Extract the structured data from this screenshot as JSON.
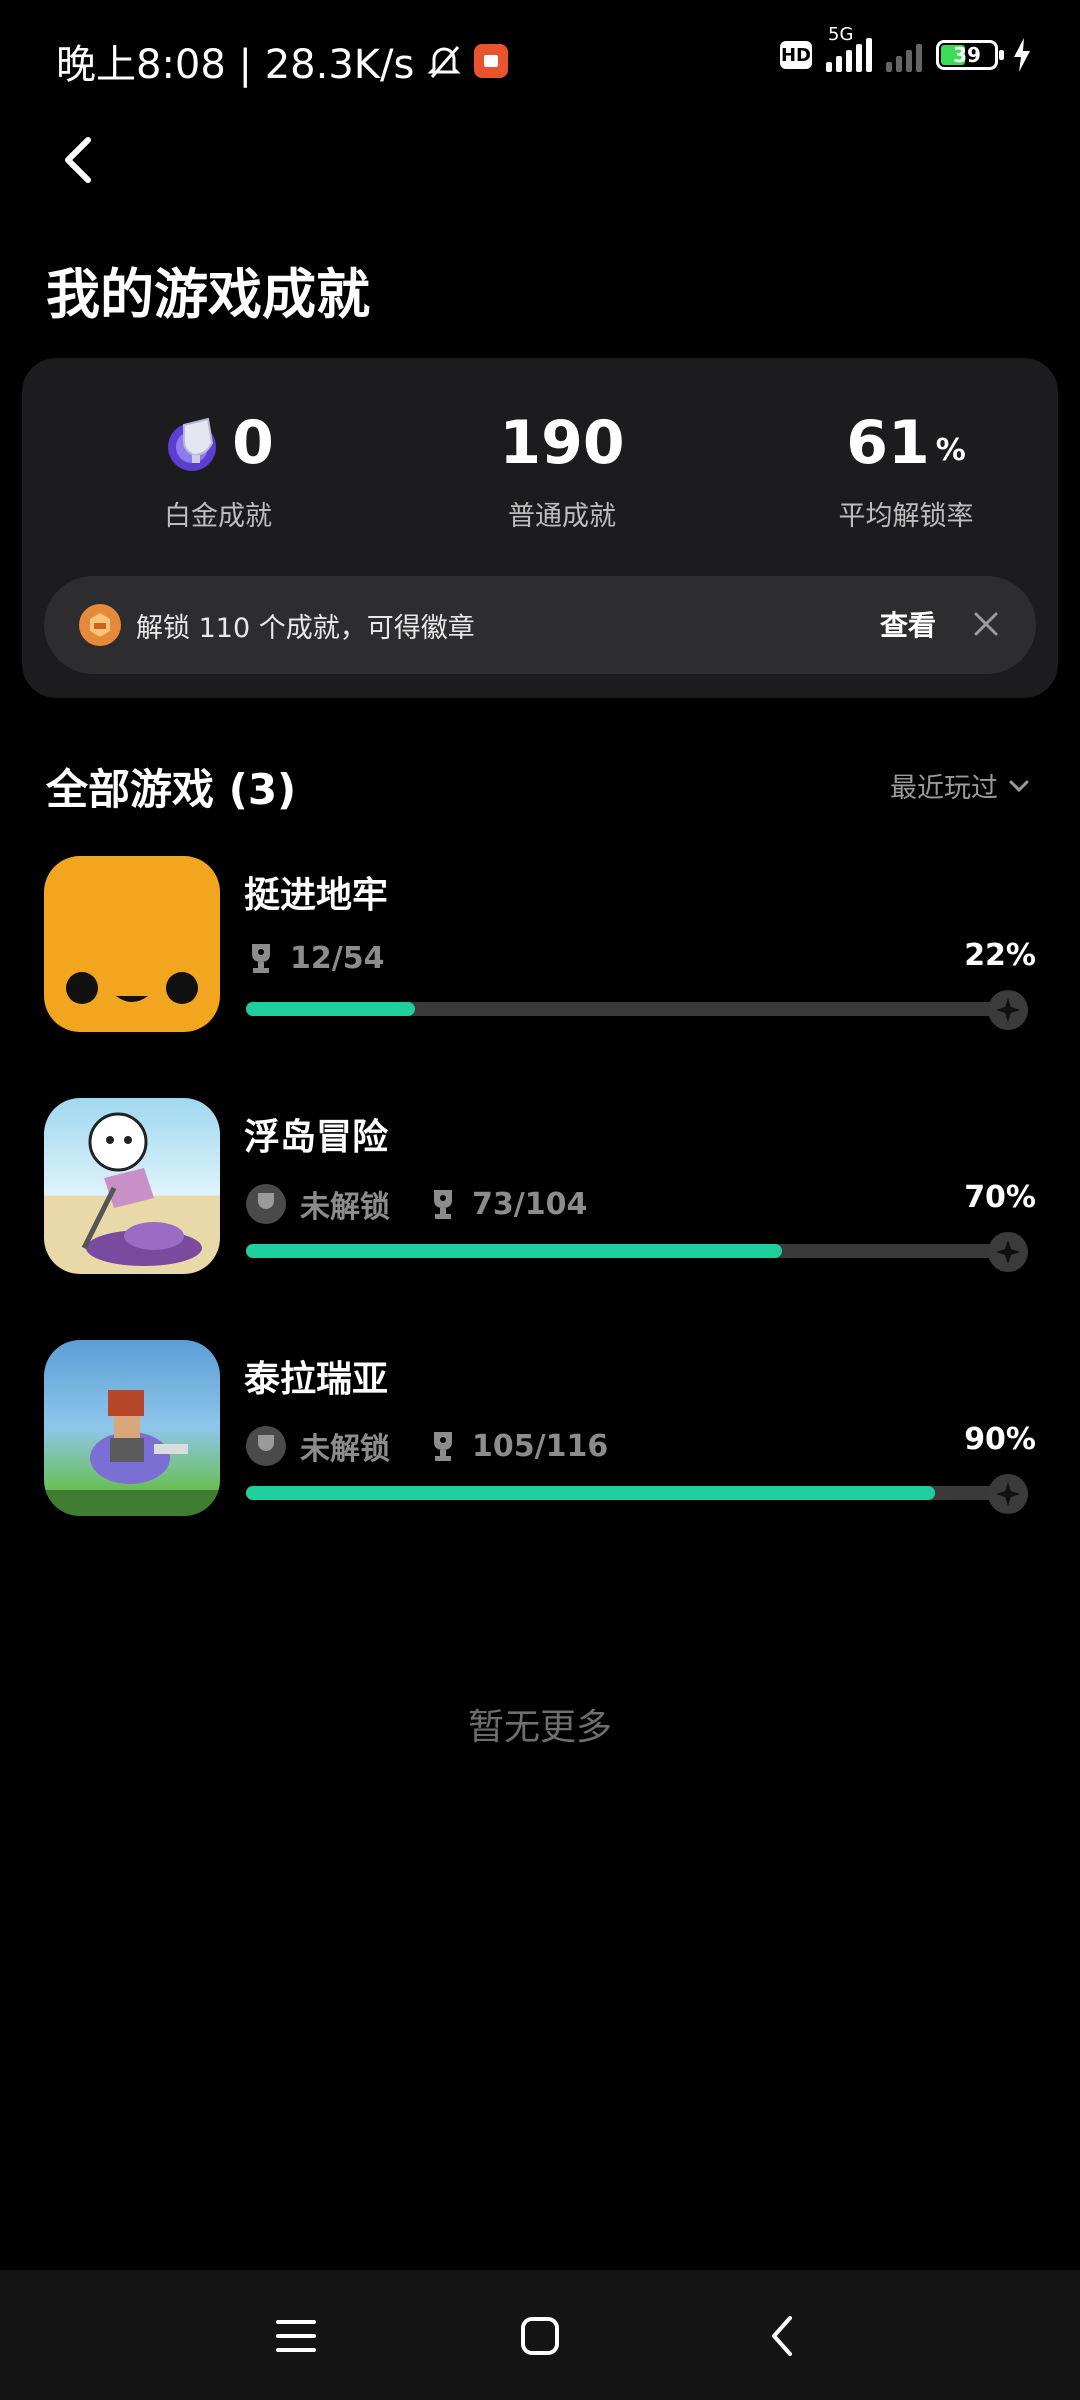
{
  "status_bar": {
    "time_text": "晚上8:08 | 28.3K/s",
    "hd": "HD",
    "network": "5G",
    "battery": "39",
    "accent_record": "#e9542f"
  },
  "header": {
    "title": "我的游戏成就"
  },
  "summary": {
    "platinum_value": "0",
    "platinum_label": "白金成就",
    "normal_value": "190",
    "normal_label": "普通成就",
    "rate_value": "61",
    "rate_unit": "%",
    "rate_label": "平均解锁率",
    "notice_text": "解锁 110 个成就，可得徽章",
    "notice_action": "查看"
  },
  "games_section": {
    "title": "全部游戏 (3)",
    "sort_label": "最近玩过"
  },
  "games": [
    {
      "name": "挺进地牢",
      "locked_label": "",
      "count": "12/54",
      "percent": "22%",
      "progress": 0.22
    },
    {
      "name": "浮岛冒险",
      "locked_label": "未解锁",
      "count": "73/104",
      "percent": "70%",
      "progress": 0.7
    },
    {
      "name": "泰拉瑞亚",
      "locked_label": "未解锁",
      "count": "105/116",
      "percent": "90%",
      "progress": 0.9
    }
  ],
  "footer": {
    "no_more": "暂无更多"
  },
  "colors": {
    "progress": "#1fcf9d",
    "card": "#1c1c1e"
  }
}
